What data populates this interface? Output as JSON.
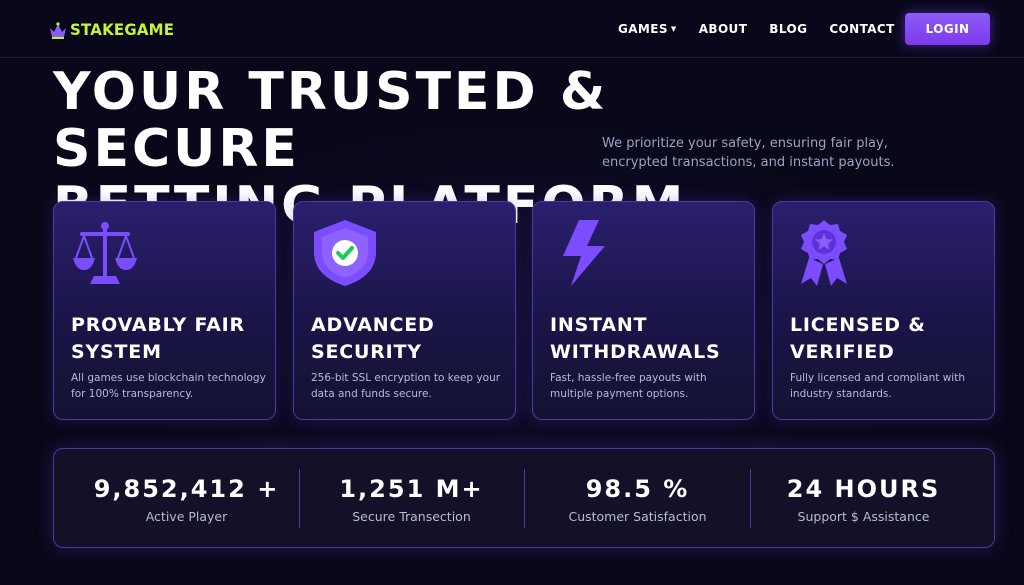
{
  "brand": {
    "name_prefix": "STAKE",
    "name_suffix": "GAME",
    "accent_color": "#c6f23a"
  },
  "nav": {
    "links": [
      {
        "label": "GAMES",
        "has_dropdown": true
      },
      {
        "label": "ABOUT"
      },
      {
        "label": "BLOG"
      },
      {
        "label": "CONTACT"
      }
    ],
    "login_label": "LOGIN",
    "login_color": "#7c3aed"
  },
  "hero": {
    "title_line1": "YOUR TRUSTED & SECURE",
    "title_line2": "BETTING PLATFORM",
    "subtitle_line1": "We prioritize your safety, ensuring fair play,",
    "subtitle_line2": "encrypted transactions, and instant payouts."
  },
  "features": [
    {
      "icon": "scales-icon",
      "title_line1": "PROVABLY FAIR",
      "title_line2": "SYSTEM",
      "desc_line1": "All games use blockchain technology",
      "desc_line2": "for 100% transparency."
    },
    {
      "icon": "shield-check-icon",
      "title_line1": "ADVANCED",
      "title_line2": "SECURITY",
      "desc_line1": "256-bit SSL encryption to keep your",
      "desc_line2": "data and funds secure."
    },
    {
      "icon": "lightning-icon",
      "title_line1": "INSTANT",
      "title_line2": "WITHDRAWALS",
      "desc_line1": "Fast, hassle-free payouts with",
      "desc_line2": "multiple payment options."
    },
    {
      "icon": "award-badge-icon",
      "title_line1": "LICENSED &",
      "title_line2": "VERIFIED",
      "desc_line1": "Fully licensed and compliant with",
      "desc_line2": "industry standards."
    }
  ],
  "stats": [
    {
      "value": "9,852,412 +",
      "label": "Active Player"
    },
    {
      "value": "1,251 M+",
      "label": "Secure Transection"
    },
    {
      "value": "98.5 %",
      "label": "Customer Satisfaction"
    },
    {
      "value": "24 HOURS",
      "label": "Support $ Assistance"
    }
  ],
  "colors": {
    "background": "#09081a",
    "card_border": "#4b3aa0",
    "icon_purple": "#7c4dff"
  }
}
